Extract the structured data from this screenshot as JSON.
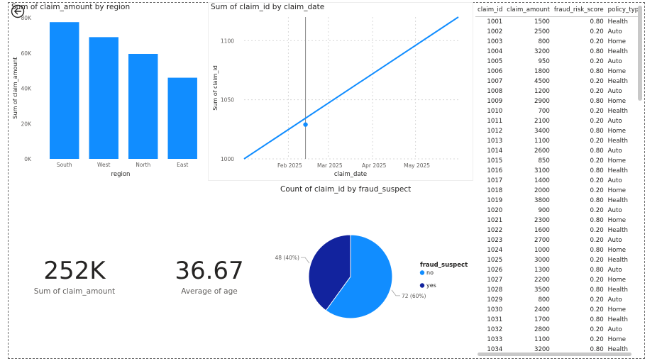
{
  "bar_chart": {
    "title": "Sum of claim_amount by region",
    "chart_data": {
      "type": "bar",
      "title": "Sum of claim_amount by region",
      "categories": [
        "South",
        "West",
        "North",
        "East"
      ],
      "values": [
        77500,
        69000,
        59500,
        46000
      ],
      "xlabel": "region",
      "ylabel": "Sum of claim_amount",
      "yticks": [
        "0K",
        "20K",
        "40K",
        "60K",
        "80K"
      ],
      "ylim": [
        0,
        80000
      ],
      "color": "#118DFF"
    }
  },
  "line_chart": {
    "title": "Sum of claim_id by claim_date",
    "chart_data": {
      "type": "line",
      "title": "Sum of claim_id by claim_date",
      "x": [
        "2025-01-01",
        "2025-05-31"
      ],
      "values": [
        1000,
        1120
      ],
      "xlabel": "claim_date",
      "ylabel": "Sum of claim_id",
      "xticks": [
        "Feb 2025",
        "Mar 2025",
        "Apr 2025",
        "May 2025"
      ],
      "yticks": [
        "1000",
        "1050",
        "1100"
      ],
      "ylim": [
        1000,
        1120
      ],
      "highlight_point": {
        "x": "2025-02-13",
        "y": 1029
      },
      "color": "#118DFF"
    }
  },
  "pie_chart": {
    "title": "Count of claim_id by fraud_suspect",
    "chart_data": {
      "type": "pie",
      "title": "Count of claim_id by fraud_suspect",
      "categories": [
        "no",
        "yes"
      ],
      "values": [
        72,
        48
      ],
      "data_labels": [
        "72 (60%)",
        "48 (40%)"
      ],
      "colors": [
        "#118DFF",
        "#12239E"
      ],
      "legend_title": "fraud_suspect"
    }
  },
  "cards": [
    {
      "value": "252K",
      "label": "Sum of claim_amount"
    },
    {
      "value": "36.67",
      "label": "Average of age"
    }
  ],
  "table": {
    "columns": [
      "claim_id",
      "claim_amount",
      "fraud_risk_score",
      "policy_type"
    ],
    "rows": [
      [
        "1001",
        "1500",
        "0.80",
        "Health"
      ],
      [
        "1002",
        "2500",
        "0.20",
        "Auto"
      ],
      [
        "1003",
        "800",
        "0.20",
        "Home"
      ],
      [
        "1004",
        "3200",
        "0.80",
        "Health"
      ],
      [
        "1005",
        "950",
        "0.20",
        "Auto"
      ],
      [
        "1006",
        "1800",
        "0.80",
        "Home"
      ],
      [
        "1007",
        "4500",
        "0.20",
        "Health"
      ],
      [
        "1008",
        "1200",
        "0.20",
        "Auto"
      ],
      [
        "1009",
        "2900",
        "0.80",
        "Home"
      ],
      [
        "1010",
        "700",
        "0.20",
        "Health"
      ],
      [
        "1011",
        "2100",
        "0.20",
        "Auto"
      ],
      [
        "1012",
        "3400",
        "0.80",
        "Home"
      ],
      [
        "1013",
        "1100",
        "0.20",
        "Health"
      ],
      [
        "1014",
        "2600",
        "0.80",
        "Auto"
      ],
      [
        "1015",
        "850",
        "0.20",
        "Home"
      ],
      [
        "1016",
        "3100",
        "0.80",
        "Health"
      ],
      [
        "1017",
        "1400",
        "0.20",
        "Auto"
      ],
      [
        "1018",
        "2000",
        "0.20",
        "Home"
      ],
      [
        "1019",
        "3800",
        "0.80",
        "Health"
      ],
      [
        "1020",
        "900",
        "0.20",
        "Auto"
      ],
      [
        "1021",
        "2300",
        "0.80",
        "Home"
      ],
      [
        "1022",
        "1600",
        "0.20",
        "Health"
      ],
      [
        "1023",
        "2700",
        "0.20",
        "Auto"
      ],
      [
        "1024",
        "1000",
        "0.80",
        "Home"
      ],
      [
        "1025",
        "3000",
        "0.20",
        "Health"
      ],
      [
        "1026",
        "1300",
        "0.80",
        "Auto"
      ],
      [
        "1027",
        "2200",
        "0.20",
        "Home"
      ],
      [
        "1028",
        "3500",
        "0.80",
        "Health"
      ],
      [
        "1029",
        "800",
        "0.20",
        "Auto"
      ],
      [
        "1030",
        "2400",
        "0.20",
        "Home"
      ],
      [
        "1031",
        "1700",
        "0.80",
        "Health"
      ],
      [
        "1032",
        "2800",
        "0.20",
        "Auto"
      ],
      [
        "1033",
        "1100",
        "0.20",
        "Home"
      ],
      [
        "1034",
        "3200",
        "0.80",
        "Health"
      ]
    ]
  }
}
